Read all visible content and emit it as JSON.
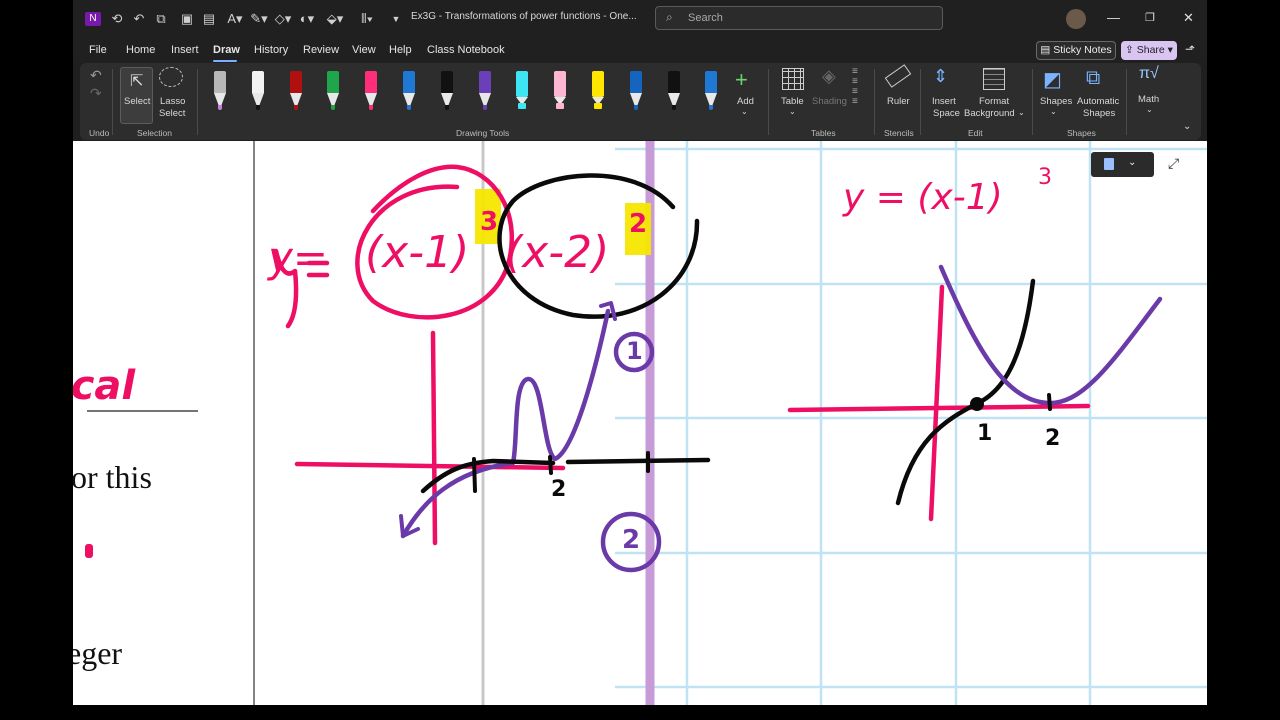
{
  "titlebar": {
    "doc_title": "Ex3G - Transformations of power functions  -  One...",
    "search_placeholder": "Search",
    "app_icon": "onenote-icon"
  },
  "menu": {
    "items": [
      "File",
      "Home",
      "Insert",
      "Draw",
      "History",
      "Review",
      "View",
      "Help",
      "Class Notebook"
    ],
    "active": "Draw",
    "sticky_notes": "Sticky Notes",
    "share": "Share"
  },
  "ribbon": {
    "undo_group": "Undo",
    "select_label": "Select",
    "lasso_label_1": "Lasso",
    "lasso_label_2": "Select",
    "selection_group": "Selection",
    "drawing_tools_group": "Drawing Tools",
    "add_label": "Add",
    "table_label": "Table",
    "shading_label": "Shading",
    "tables_group": "Tables",
    "ruler_label": "Ruler",
    "stencils_group": "Stencils",
    "insert_space_1": "Insert",
    "insert_space_2": "Space",
    "format_bg_1": "Format",
    "format_bg_2": "Background",
    "edit_group": "Edit",
    "shapes_label": "Shapes",
    "auto_shapes_1": "Automatic",
    "auto_shapes_2": "Shapes",
    "shapes_group": "Shapes",
    "math_label": "Math",
    "pens": [
      {
        "color": "#b8b8b8",
        "nib": "#c77ee0"
      },
      {
        "color": "#f2f2f2",
        "nib": "#111111"
      },
      {
        "color": "#b01010",
        "nib": "#b01010"
      },
      {
        "color": "#1fa64a",
        "nib": "#1fa64a"
      },
      {
        "color": "#ff2e7a",
        "nib": "#ff2e7a"
      },
      {
        "color": "#1f78d6",
        "nib": "#1f78d6"
      },
      {
        "color": "#111111",
        "nib": "#111111"
      },
      {
        "color": "#6b3fb8",
        "nib": "#6b3fb8"
      }
    ],
    "highlighters": [
      {
        "color": "#3de6f2"
      },
      {
        "color": "#ffb6d2"
      },
      {
        "color": "#ffe500"
      }
    ],
    "pens2": [
      {
        "color": "#1565c0",
        "nib": "#1565c0"
      },
      {
        "color": "#111111",
        "nib": "#111111"
      },
      {
        "color": "#1f78d6",
        "nib": "#1f78d6"
      }
    ]
  },
  "page": {
    "partial_word_1": "ical",
    "text_line_1": "or this",
    "text_line_2": "eger"
  },
  "ink": {
    "left_equation_y": "y=",
    "factor_1": "(x-1)",
    "exponent_1": "3",
    "factor_2": "(x-2)",
    "exponent_2": "2",
    "left_tick_2": "2",
    "circle_label_1": "1",
    "circle_label_2": "2",
    "right_equation": "y = (x-1)",
    "right_exponent": "3",
    "right_tick_1": "1",
    "right_tick_2": "2"
  },
  "colors": {
    "ink_pink": "#ee0f64",
    "ink_black": "#0a0a0a",
    "ink_purple": "#6a3aa8",
    "ink_yellow": "#f5e600",
    "grid_blue": "#bfe3f3",
    "guide_purple": "#c79ad8"
  }
}
